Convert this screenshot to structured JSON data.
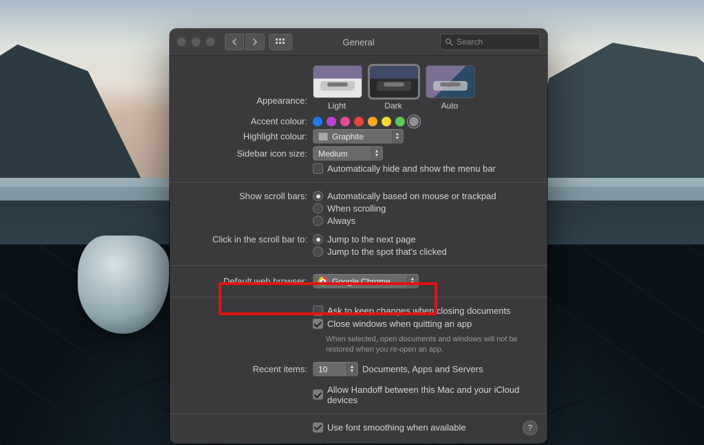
{
  "window": {
    "title": "General"
  },
  "search": {
    "placeholder": "Search"
  },
  "appearance": {
    "label": "Appearance:",
    "options": [
      "Light",
      "Dark",
      "Auto"
    ],
    "selected": "Dark"
  },
  "accent": {
    "label": "Accent colour:",
    "colors": [
      "#1e7bf0",
      "#b944d6",
      "#e84a9a",
      "#e8453c",
      "#f5a623",
      "#f7d737",
      "#5bc85b",
      "#8e8e93"
    ],
    "selected_index": 7
  },
  "highlight": {
    "label": "Highlight colour:",
    "value": "Graphite"
  },
  "sidebar_size": {
    "label": "Sidebar icon size:",
    "value": "Medium"
  },
  "menubar_autohide": {
    "label": "Automatically hide and show the menu bar",
    "checked": false
  },
  "scroll_bars": {
    "label": "Show scroll bars:",
    "options": [
      "Automatically based on mouse or trackpad",
      "When scrolling",
      "Always"
    ],
    "selected_index": 0
  },
  "click_scroll": {
    "label": "Click in the scroll bar to:",
    "options": [
      "Jump to the next page",
      "Jump to the spot that's clicked"
    ],
    "selected_index": 0
  },
  "default_browser": {
    "label": "Default web browser:",
    "value": "Google Chrome"
  },
  "ask_changes": {
    "label": "Ask to keep changes when closing documents",
    "checked": false
  },
  "close_windows": {
    "label": "Close windows when quitting an app",
    "checked": true,
    "help": "When selected, open documents and windows will not be restored when you re-open an app."
  },
  "recent_items": {
    "label": "Recent items:",
    "value": "10",
    "suffix": "Documents, Apps and Servers"
  },
  "handoff": {
    "label": "Allow Handoff between this Mac and your iCloud devices",
    "checked": true
  },
  "font_smoothing": {
    "label": "Use font smoothing when available",
    "checked": true
  }
}
